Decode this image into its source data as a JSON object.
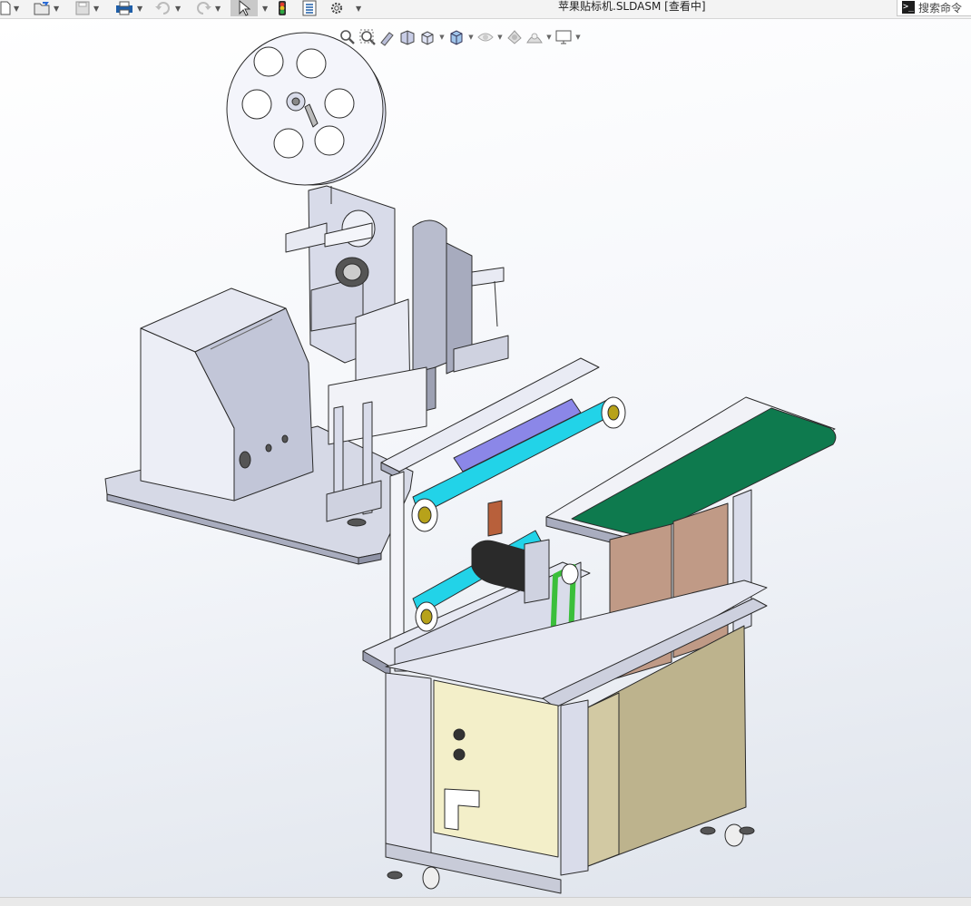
{
  "window": {
    "title": "苹果贴标机.SLDASM [查看中]"
  },
  "search": {
    "label": "搜索命令",
    "icon": "command-prompt-icon"
  },
  "toolbar": {
    "items": [
      {
        "icon": "new-document-icon"
      },
      {
        "icon": "open-icon"
      },
      {
        "icon": "save-icon"
      },
      {
        "icon": "print-icon"
      },
      {
        "icon": "undo-icon"
      },
      {
        "icon": "redo-icon"
      },
      {
        "icon": "select-pointer-icon",
        "active": true
      },
      {
        "icon": "rebuild-traffic-light-icon"
      },
      {
        "icon": "file-properties-icon"
      },
      {
        "icon": "options-gear-icon"
      }
    ]
  },
  "heads_up_toolbar": {
    "items": [
      "zoom-to-fit-icon",
      "zoom-to-area-icon",
      "previous-view-icon",
      "section-view-icon",
      "view-orientation-icon",
      "display-style-icon",
      "hide-show-items-icon",
      "edit-appearance-icon",
      "apply-scene-icon",
      "view-settings-icon"
    ]
  },
  "model": {
    "name": "apple-labeling-machine-assembly",
    "colors": {
      "steel": "#d9dce8",
      "edge": "#2b2b2b",
      "belt_cyan": "#22d3e8",
      "belt_purple": "#8b87e8",
      "conveyor_green": "#0e7a4e",
      "cabinet_yellow": "#f3efc9",
      "door_khaki": "#bdb38d",
      "panel_brown": "#c09a86",
      "wheel_olive": "#b7a21a",
      "chain_green": "#3bbf3b"
    }
  }
}
